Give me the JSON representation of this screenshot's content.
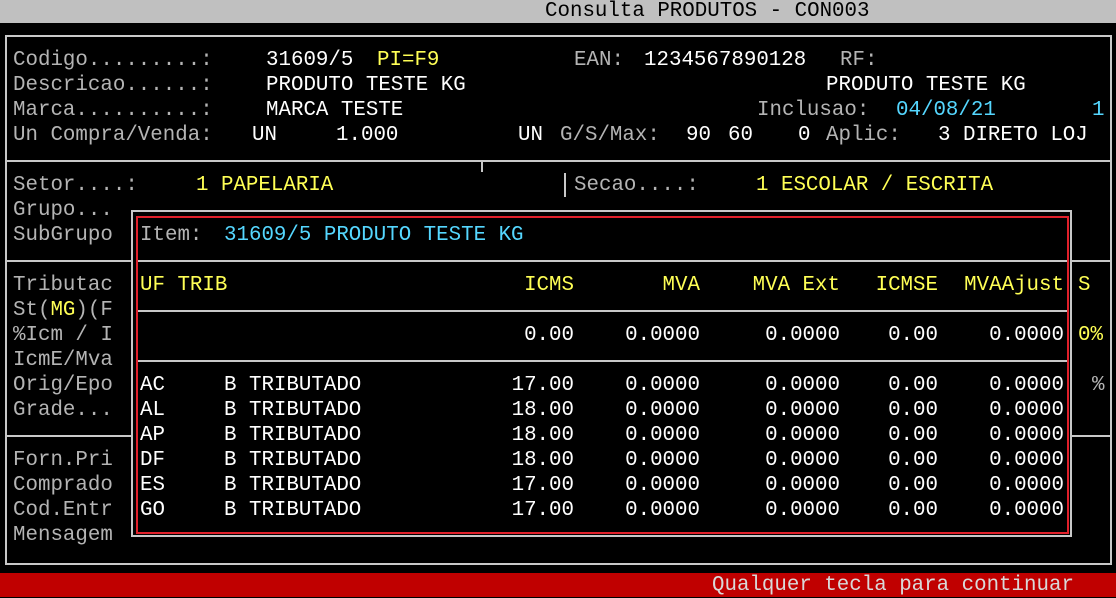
{
  "window": {
    "title": "Consulta PRODUTOS - CON003"
  },
  "status": {
    "message": "Qualquer tecla para continuar"
  },
  "product": {
    "codigo_label": "Codigo.........:",
    "codigo_value": "31609/5",
    "pi_hint": "PI=F9",
    "ean_label": "EAN:",
    "ean_value": "1234567890128",
    "rf_label": "RF:",
    "descricao_label": "Descricao......:",
    "descricao_value": "PRODUTO TESTE KG",
    "descricao_alt": "PRODUTO TESTE KG",
    "marca_label": "Marca..........:",
    "marca_value": "MARCA TESTE",
    "inclusao_label": "Inclusao:",
    "inclusao_date": "04/08/21",
    "inclusao_extra": "1",
    "uncompra_label": "Un Compra/Venda:",
    "un_compra": "UN",
    "fator": "1.000",
    "un_venda": "UN",
    "gsmax_label": "G/S/Max:",
    "g_value": "90",
    "s_value": "60",
    "max_value": "0",
    "aplic_label": "Aplic:",
    "aplic_value": "3 DIRETO LOJ"
  },
  "classification": {
    "setor_label": "Setor....:",
    "setor_value": "1 PAPELARIA",
    "secao_label": "Secao....:",
    "secao_value": "1 ESCOLAR / ESCRITA",
    "grupo_label": "Grupo...",
    "subgrupo_label": "SubGrupo"
  },
  "fiscal": {
    "tributac_label": "Tributac",
    "st_label": "St(",
    "st_uf": "MG",
    "st_suffix": ")(F",
    "icm_label": "%Icm / I",
    "icme_label": "IcmE/Mva",
    "orig_label": "Orig/Epo",
    "grade_label": "Grade...",
    "right_pct1": "0%",
    "right_pct2": "%"
  },
  "supplier": {
    "forn_label": "Forn.Pri",
    "comprador_label": "Comprado",
    "codentr_label": "Cod.Entr",
    "mensagem_label": "Mensagem"
  },
  "popup": {
    "item_label": "Item:",
    "item_value": "31609/5 PRODUTO TESTE KG",
    "headers": {
      "uf_trib": "UF TRIB",
      "icms": "ICMS",
      "mva": "MVA",
      "mva_ext": "MVA Ext",
      "icmse": "ICMSE",
      "mvaajust": "MVAAjust",
      "s": "S"
    },
    "defaults": {
      "icms": "0.00",
      "mva": "0.0000",
      "mva_ext": "0.0000",
      "icmse": "0.00",
      "mvaajust": "0.0000"
    },
    "rows": [
      {
        "uf": "AC",
        "trib": "B TRIBUTADO",
        "icms": "17.00",
        "mva": "0.0000",
        "mva_ext": "0.0000",
        "icmse": "0.00",
        "mvaajust": "0.0000"
      },
      {
        "uf": "AL",
        "trib": "B TRIBUTADO",
        "icms": "18.00",
        "mva": "0.0000",
        "mva_ext": "0.0000",
        "icmse": "0.00",
        "mvaajust": "0.0000"
      },
      {
        "uf": "AP",
        "trib": "B TRIBUTADO",
        "icms": "18.00",
        "mva": "0.0000",
        "mva_ext": "0.0000",
        "icmse": "0.00",
        "mvaajust": "0.0000"
      },
      {
        "uf": "DF",
        "trib": "B TRIBUTADO",
        "icms": "18.00",
        "mva": "0.0000",
        "mva_ext": "0.0000",
        "icmse": "0.00",
        "mvaajust": "0.0000"
      },
      {
        "uf": "ES",
        "trib": "B TRIBUTADO",
        "icms": "17.00",
        "mva": "0.0000",
        "mva_ext": "0.0000",
        "icmse": "0.00",
        "mvaajust": "0.0000"
      },
      {
        "uf": "GO",
        "trib": "B TRIBUTADO",
        "icms": "17.00",
        "mva": "0.0000",
        "mva_ext": "0.0000",
        "icmse": "0.00",
        "mvaajust": "0.0000"
      }
    ]
  },
  "colors": {
    "background": "#000000",
    "titlebar": "#c0c0c0",
    "statusbar": "#c00000",
    "popup_border": "#e0202a",
    "highlight_yellow": "#ffff55",
    "highlight_cyan": "#55d7ff"
  }
}
